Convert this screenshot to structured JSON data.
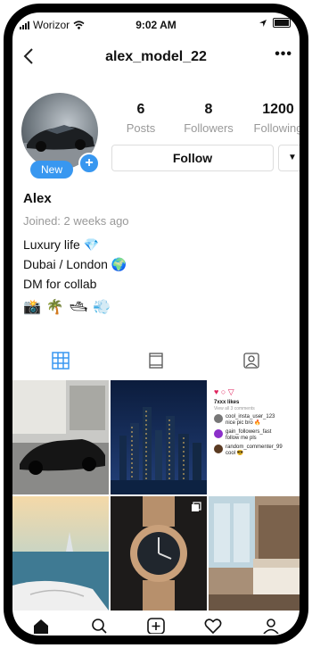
{
  "status": {
    "carrier": "Worizor",
    "time": "9:02 AM"
  },
  "header": {
    "title": "alex_model_22"
  },
  "profile": {
    "new_badge": "New",
    "stats": [
      {
        "value": "6",
        "label": "Posts"
      },
      {
        "value": "8",
        "label": "Followers"
      },
      {
        "value": "1200",
        "label": "Following"
      }
    ],
    "follow_label": "Follow",
    "name": "Alex",
    "joined": "Joined: 2 weeks ago",
    "bio": [
      "Luxury life 💎",
      "Dubai / London 🌍",
      "DM for collab"
    ],
    "emojis": [
      "📸",
      "🌴",
      "🛥",
      "💨"
    ]
  },
  "post3": {
    "likes": "7xxx likes",
    "view": "View all 3 comments",
    "comments": [
      {
        "user": "cool_insta_user_123",
        "text": "nice pic bro 🔥"
      },
      {
        "user": "gain_followers_fast",
        "text": "follow me pls"
      },
      {
        "user": "random_commenter_99",
        "text": "cool 😎"
      }
    ]
  },
  "icons": {
    "tabs": [
      "grid-icon",
      "reels-icon",
      "tagged-icon"
    ],
    "bottom": [
      "home-icon",
      "search-icon",
      "new-post-icon",
      "heart-icon",
      "profile-icon"
    ]
  },
  "colors": {
    "accent": "#3897f0"
  }
}
